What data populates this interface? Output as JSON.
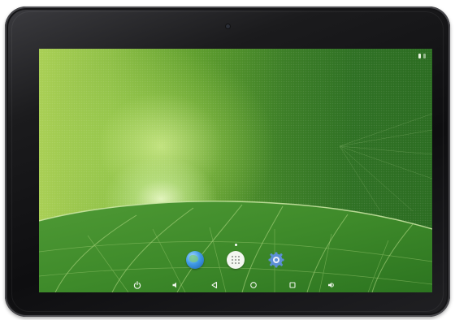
{
  "device": {
    "bezel_color": "#141416",
    "wallpaper": "green-leaf-wallpaper"
  },
  "status_bar": {
    "icons": [
      "battery-icon"
    ]
  },
  "dock": {
    "items": [
      {
        "name": "browser-icon"
      },
      {
        "name": "app-drawer-icon"
      },
      {
        "name": "settings-icon"
      }
    ]
  },
  "nav_bar": {
    "buttons": [
      {
        "name": "power-icon"
      },
      {
        "name": "volume-down-icon"
      },
      {
        "name": "back-icon"
      },
      {
        "name": "home-icon"
      },
      {
        "name": "recents-icon"
      },
      {
        "name": "volume-up-icon"
      }
    ]
  },
  "colors": {
    "wallpaper_light": "#a9cf55",
    "wallpaper_dark": "#2c6d22",
    "nav_icon": "#f0f5ec"
  }
}
